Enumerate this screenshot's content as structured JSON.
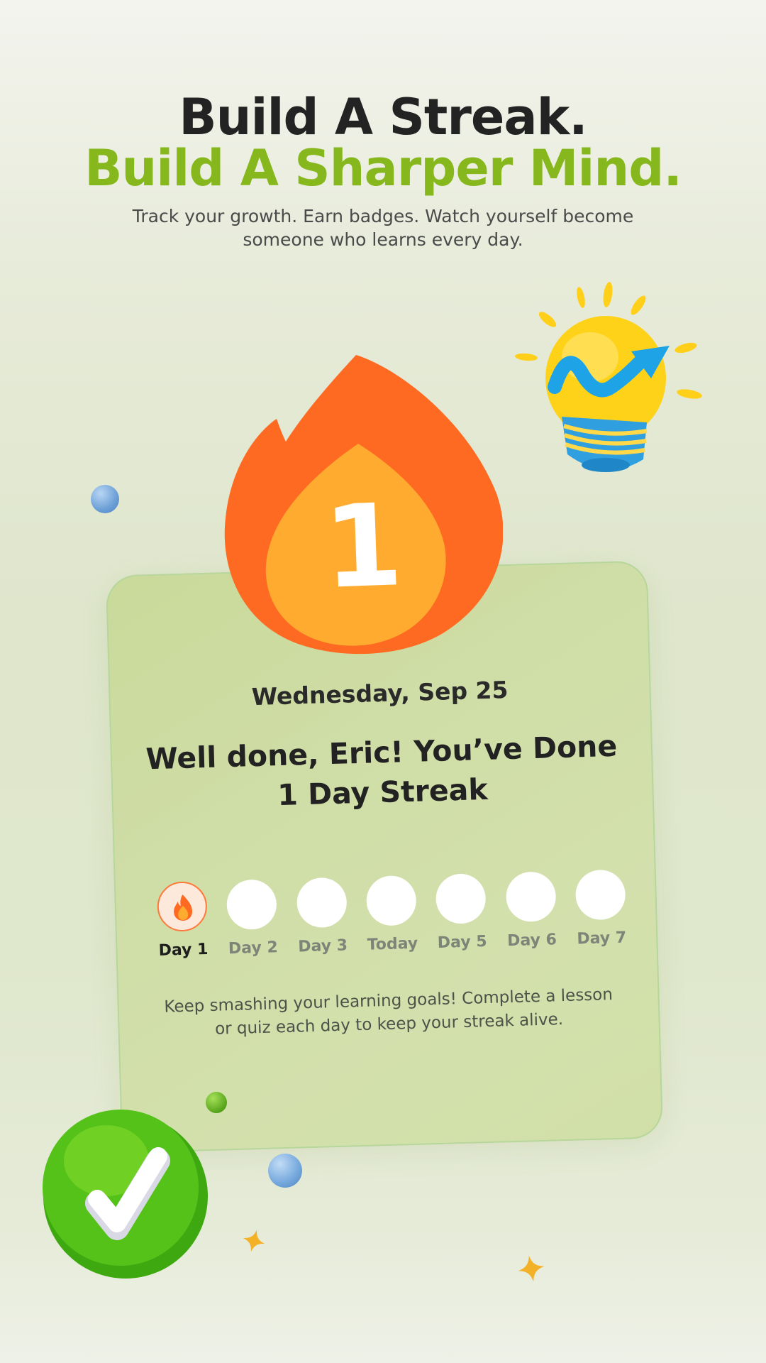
{
  "header": {
    "line1": "Build A Streak.",
    "line2": "Build A Sharper Mind.",
    "subtitle": "Track your growth. Earn badges. Watch yourself become someone who learns every day."
  },
  "streak": {
    "count": "1",
    "date": "Wednesday, Sep 25",
    "message": "Well done, Eric! You’ve Done 1 Day Streak",
    "days": [
      {
        "label": "Day 1",
        "completed": true
      },
      {
        "label": "Day 2",
        "completed": false
      },
      {
        "label": "Day 3",
        "completed": false
      },
      {
        "label": "Today",
        "completed": false
      },
      {
        "label": "Day 5",
        "completed": false
      },
      {
        "label": "Day 6",
        "completed": false
      },
      {
        "label": "Day 7",
        "completed": false
      }
    ],
    "note": "Keep smashing your learning goals! Complete a lesson or quiz each day to keep your streak alive."
  },
  "colors": {
    "accent_green": "#86b81e",
    "flame_outer": "#ff6a22",
    "flame_inner": "#ffab2f",
    "card_bg": "#cfdda6"
  },
  "decorations": {
    "icons": [
      "lightbulb-growth-icon",
      "checkmark-badge-icon",
      "fire-icon",
      "star-icon",
      "orb"
    ]
  }
}
